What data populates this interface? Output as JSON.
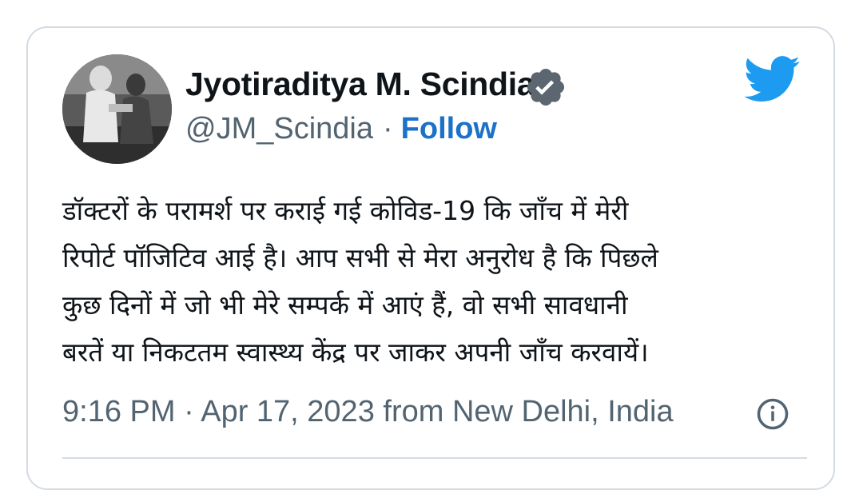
{
  "author": {
    "name": "Jyotiraditya M. Scindia",
    "handle": "@JM_Scindia",
    "separator": "·",
    "follow_label": "Follow",
    "verified_icon": "verified-badge-icon",
    "avatar": "profile-photo"
  },
  "tweet": {
    "text": "डॉक्टरों के परामर्श पर कराई गई कोविड-19 कि जाँच में मेरी\nरिपोर्ट पॉजिटिव आई है। आप सभी से मेरा अनुरोध है कि पिछले\nकुछ दिनों में जो भी मेरे सम्पर्क में आएं हैं, वो सभी सावधानी\nबरतें या निकटतम स्वास्थ्य केंद्र पर जाकर अपनी जाँच करवायें।",
    "time": "9:16 PM",
    "separator": "·",
    "date": "Apr 17, 2023",
    "location": "from New Delhi, India"
  },
  "icons": {
    "brand": "twitter-bird-icon",
    "info": "info-icon"
  },
  "colors": {
    "link": "#1b72c8",
    "brand": "#1d9bf0",
    "muted": "#536471",
    "verified": "#5b6670"
  }
}
